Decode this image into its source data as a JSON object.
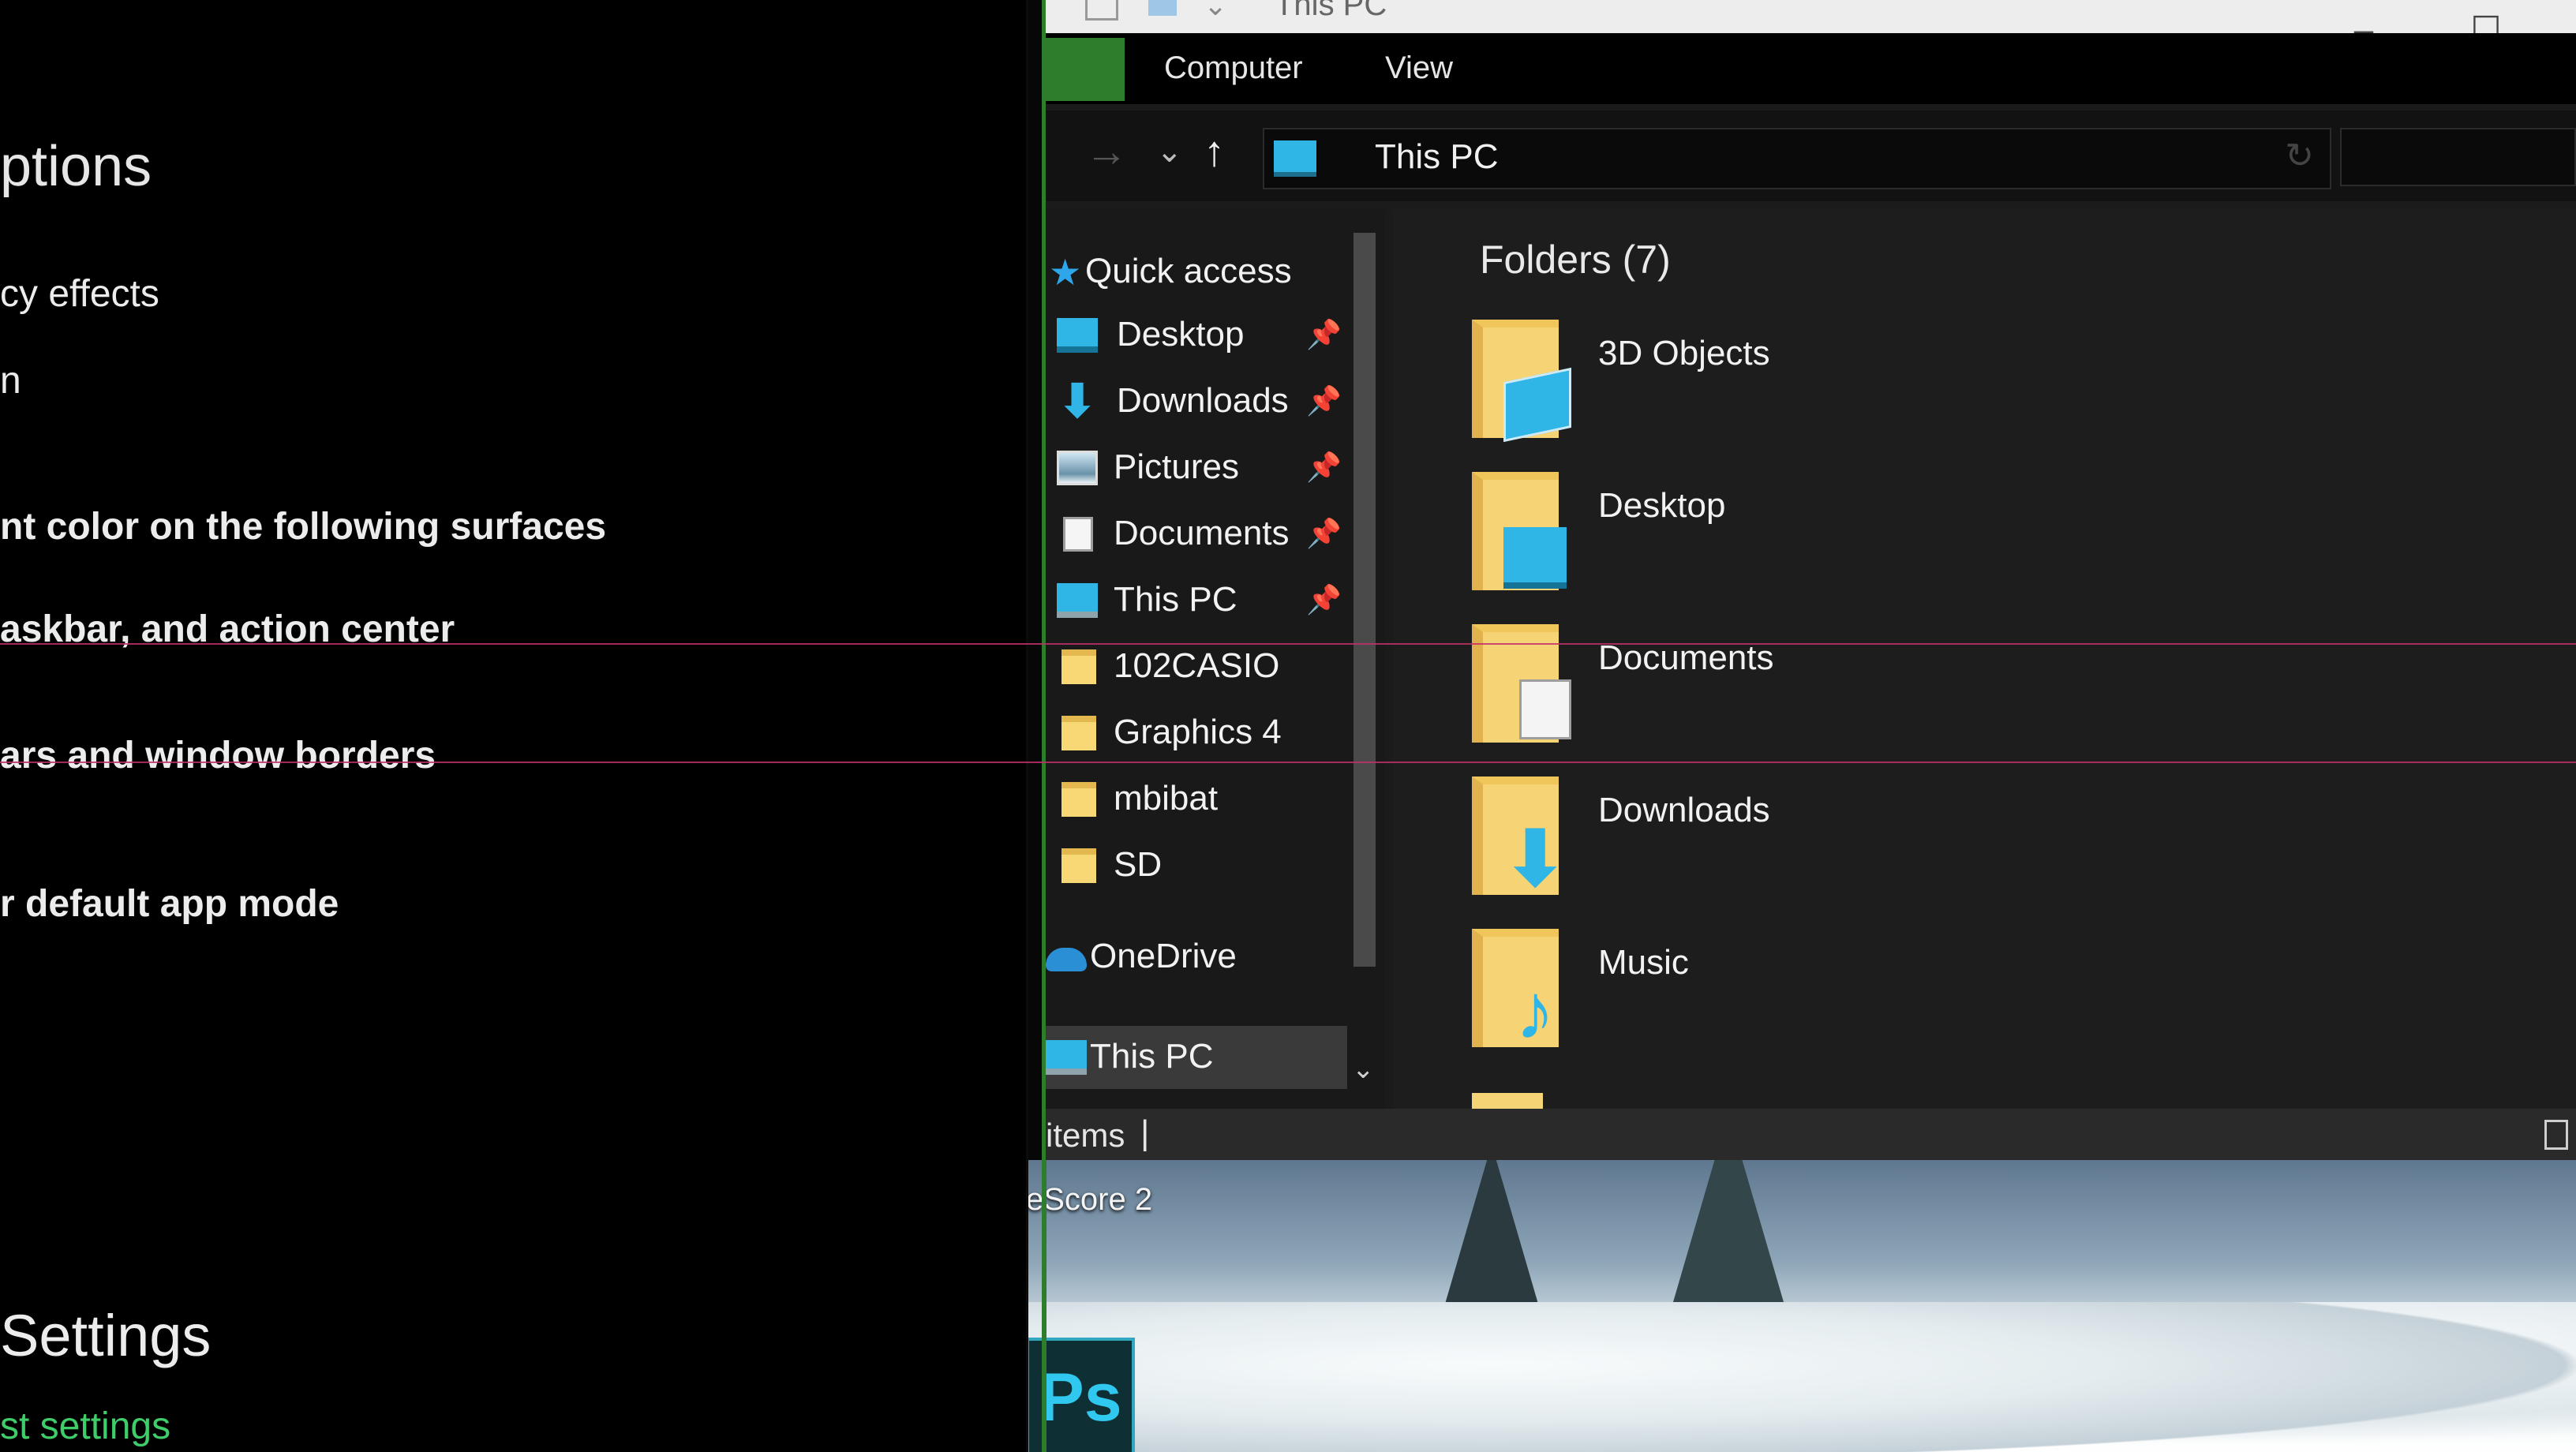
{
  "settings": {
    "title": "ptions",
    "lines": [
      "cy effects",
      "n",
      "nt color on the following surfaces",
      "askbar, and action center",
      "ars and window borders",
      "r default app mode"
    ],
    "section_title": "Settings",
    "link": "st settings"
  },
  "explorer": {
    "window_title": "This PC",
    "ribbon_tabs": [
      "Computer",
      "View"
    ],
    "address": "This PC",
    "nav": {
      "quick_access": "Quick access",
      "items": [
        {
          "label": "Desktop",
          "icon": "desktop-icon",
          "pinned": true
        },
        {
          "label": "Downloads",
          "icon": "download-arrow-icon",
          "pinned": true
        },
        {
          "label": "Pictures",
          "icon": "pictures-icon",
          "pinned": true
        },
        {
          "label": "Documents",
          "icon": "document-icon",
          "pinned": true
        },
        {
          "label": "This PC",
          "icon": "computer-icon",
          "pinned": true
        },
        {
          "label": "102CASIO",
          "icon": "folder-icon",
          "pinned": false
        },
        {
          "label": "Graphics 4",
          "icon": "folder-icon",
          "pinned": false
        },
        {
          "label": "mbibat",
          "icon": "folder-icon",
          "pinned": false
        },
        {
          "label": "SD",
          "icon": "folder-icon",
          "pinned": false
        }
      ],
      "onedrive": "OneDrive",
      "this_pc": "This PC"
    },
    "group_title": "Folders (7)",
    "folders": [
      {
        "label": "3D Objects",
        "badge": "cube-icon"
      },
      {
        "label": "Desktop",
        "badge": "desktop-icon"
      },
      {
        "label": "Documents",
        "badge": "document-icon"
      },
      {
        "label": "Downloads",
        "badge": "download-arrow-icon"
      },
      {
        "label": "Music",
        "badge": "music-note-icon"
      }
    ],
    "status": "items",
    "colors": {
      "accent_green": "#2d7d2d",
      "icon_blue": "#2fb6e6",
      "folder_yellow": "#f6d374"
    }
  },
  "desktop": {
    "label": "eScore 2",
    "ps_tile": "Ps"
  }
}
